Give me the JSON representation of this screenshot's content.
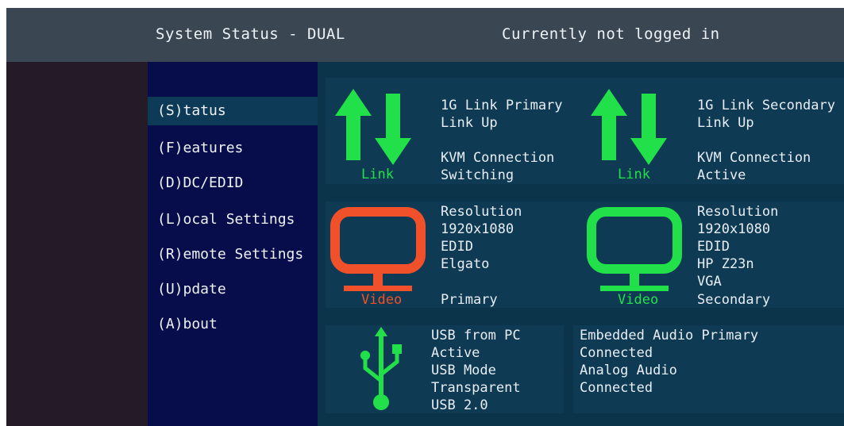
{
  "header": {
    "title": "System Status - DUAL",
    "login_status": "Currently not logged in"
  },
  "menu": [
    {
      "label": "(S)tatus",
      "active": true
    },
    {
      "label": "(F)eatures",
      "active": false
    },
    {
      "label": "(D)DC/EDID",
      "active": false
    },
    {
      "label": "(L)ocal  Settings",
      "active": false
    },
    {
      "label": "(R)emote Settings",
      "active": false
    },
    {
      "label": "(U)pdate",
      "active": false
    },
    {
      "label": "(A)bout",
      "active": false
    }
  ],
  "link_primary": {
    "icon": "link-arrows-icon",
    "color": "#22e04a",
    "label": "Link",
    "line1": "1G Link Primary",
    "line2": "Link Up",
    "line3": "KVM Connection",
    "line4": "Switching"
  },
  "link_secondary": {
    "icon": "link-arrows-icon",
    "color": "#22e04a",
    "label": "Link",
    "line1": "1G Link Secondary",
    "line2": "Link Up",
    "line3": "KVM Connection",
    "line4": "Active"
  },
  "video_primary": {
    "icon": "monitor-icon",
    "color": "#f0512a",
    "label": "Video",
    "lines": [
      "Resolution",
      "1920x1080",
      "EDID",
      "Elgato"
    ],
    "role": "Primary"
  },
  "video_secondary": {
    "icon": "monitor-icon",
    "color": "#22e04a",
    "label": "Video",
    "lines": [
      "Resolution",
      "1920x1080",
      "EDID",
      "HP Z23n",
      "VGA"
    ],
    "role": "Secondary"
  },
  "usb": {
    "icon": "usb-icon",
    "color": "#22e04a",
    "lines": [
      "USB from PC",
      "Active",
      "USB Mode",
      "Transparent",
      "USB 2.0"
    ]
  },
  "audio": {
    "lines": [
      "Embedded Audio Primary",
      "Connected",
      "Analog Audio",
      "Connected"
    ]
  }
}
